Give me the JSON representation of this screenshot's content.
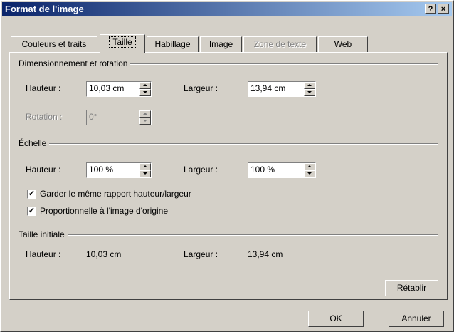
{
  "window": {
    "title": "Format de l'image",
    "help_label": "?",
    "close_label": "×"
  },
  "tabs": [
    {
      "label": "Couleurs et traits",
      "state": "normal"
    },
    {
      "label": "Taille",
      "state": "active"
    },
    {
      "label": "Habillage",
      "state": "normal"
    },
    {
      "label": "Image",
      "state": "normal"
    },
    {
      "label": "Zone de texte",
      "state": "disabled"
    },
    {
      "label": "Web",
      "state": "normal"
    }
  ],
  "dimensionnement": {
    "title": "Dimensionnement et rotation",
    "hauteur_label": "Hauteur :",
    "hauteur_value": "10,03 cm",
    "largeur_label": "Largeur :",
    "largeur_value": "13,94 cm",
    "rotation_label": "Rotation :",
    "rotation_value": "0°"
  },
  "echelle": {
    "title": "Échelle",
    "hauteur_label": "Hauteur :",
    "hauteur_value": "100 %",
    "largeur_label": "Largeur :",
    "largeur_value": "100 %",
    "lock_ratio_label": "Garder le même rapport hauteur/largeur",
    "lock_ratio_checked": true,
    "relative_label": "Proportionnelle à l'image d'origine",
    "relative_checked": true
  },
  "taille_initiale": {
    "title": "Taille initiale",
    "hauteur_label": "Hauteur :",
    "hauteur_value": "10,03 cm",
    "largeur_label": "Largeur :",
    "largeur_value": "13,94 cm"
  },
  "buttons": {
    "reset": "Rétablir",
    "ok": "OK",
    "cancel": "Annuler"
  }
}
